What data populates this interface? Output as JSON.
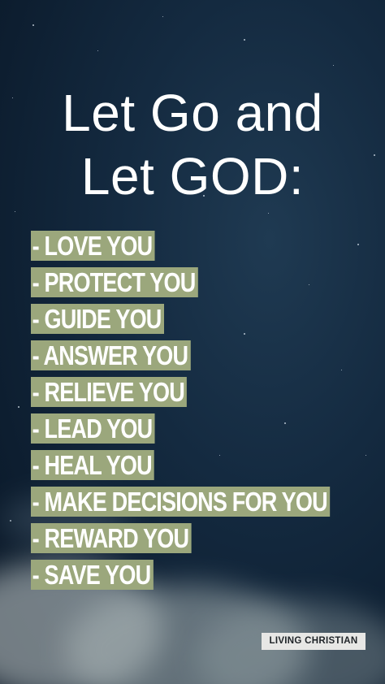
{
  "title": {
    "line1": "Let Go and",
    "line2": "Let GOD:"
  },
  "list": [
    "- LOVE YOU",
    "- PROTECT YOU",
    "- GUIDE YOU",
    "- ANSWER YOU",
    "- RELIEVE YOU",
    "- LEAD YOU",
    "- HEAL YOU",
    "- MAKE DECISIONS FOR YOU",
    "- REWARD YOU",
    "- SAVE YOU"
  ],
  "badge": "LIVING CHRISTIAN",
  "colors": {
    "sky": "#142a40",
    "highlight": "#9ba77c",
    "text": "#ffffff",
    "badge_bg": "#e7e7e5"
  }
}
